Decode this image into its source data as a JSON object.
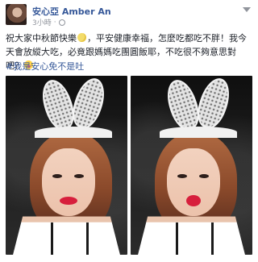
{
  "post": {
    "author_name": "安心亞 Amber An",
    "timestamp": "3小時",
    "text_part1": "祝大家中秋節快樂",
    "text_part2": "，平安健康幸福，怎麼吃都吃不胖！我今天會放縱大吃，必竟跟媽媽吃團圓飯耶，不吃很不夠意思對吧？",
    "hashtag": "#我是安心免不是吐",
    "emoji_icons": [
      "moon-emoji",
      "tongue-emoji"
    ],
    "photo_count": 2
  },
  "colors": {
    "link": "#365899",
    "meta": "#90949c",
    "text": "#1d2129",
    "lipstick": "#d71f3c"
  }
}
